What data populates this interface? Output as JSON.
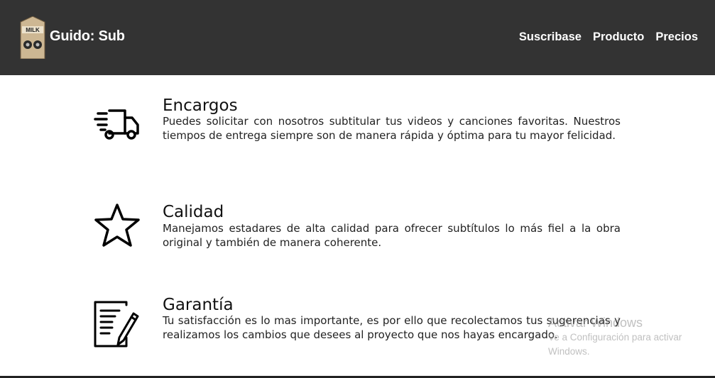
{
  "header": {
    "logo_text": "MILK",
    "brand": "Guido: Sub",
    "nav": [
      "Suscribase",
      "Producto",
      "Precios"
    ]
  },
  "features": [
    {
      "icon": "delivery-truck-icon",
      "title": "Encargos",
      "description": "Puedes solicitar con nosotros subtitular tus videos y canciones favoritas. Nuestros tiempos de entrega siempre son de manera rápida y óptima para tu mayor felicidad."
    },
    {
      "icon": "star-icon",
      "title": "Calidad",
      "description": "Manejamos estadares de alta calidad para ofrecer subtítulos lo más fiel a la obra original y también de manera coherente."
    },
    {
      "icon": "document-pencil-icon",
      "title": "Garantía",
      "description": "Tu satisfacción es lo mas importante, es por ello que recolectamos tus sugerencias y realizamos los cambios que desees al proyecto que nos hayas encargado."
    }
  ],
  "watermark": {
    "title": "Activar Windows",
    "subtitle": "Ve a Configuración para activar Windows."
  },
  "colors": {
    "header_bg": "#333333",
    "nav_text": "#ffffff",
    "body_bg": "#ffffff"
  }
}
